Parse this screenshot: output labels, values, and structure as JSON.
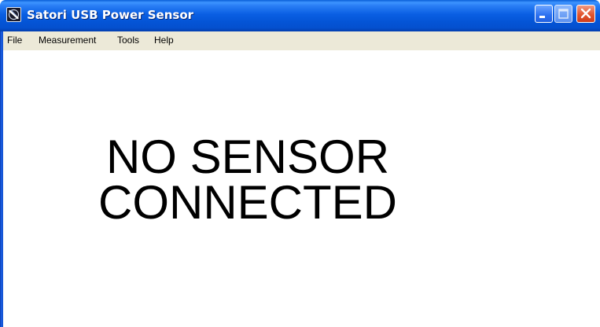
{
  "window": {
    "title": "Satori USB Power Sensor",
    "app_icon": "satori-app-icon",
    "controls": [
      "minimize-icon",
      "maximize-icon",
      "close-icon"
    ]
  },
  "menu": {
    "items": [
      {
        "label": "File"
      },
      {
        "label": "Measurement"
      },
      {
        "label": "Tools"
      },
      {
        "label": "Help"
      }
    ]
  },
  "main": {
    "status_line1": "NO SENSOR",
    "status_line2": "CONNECTED"
  },
  "colors": {
    "titlebar": "#0454d6",
    "menubar": "#ece9d8",
    "close_button": "#e2562f",
    "background": "#ffffff",
    "status_text": "#000000"
  }
}
